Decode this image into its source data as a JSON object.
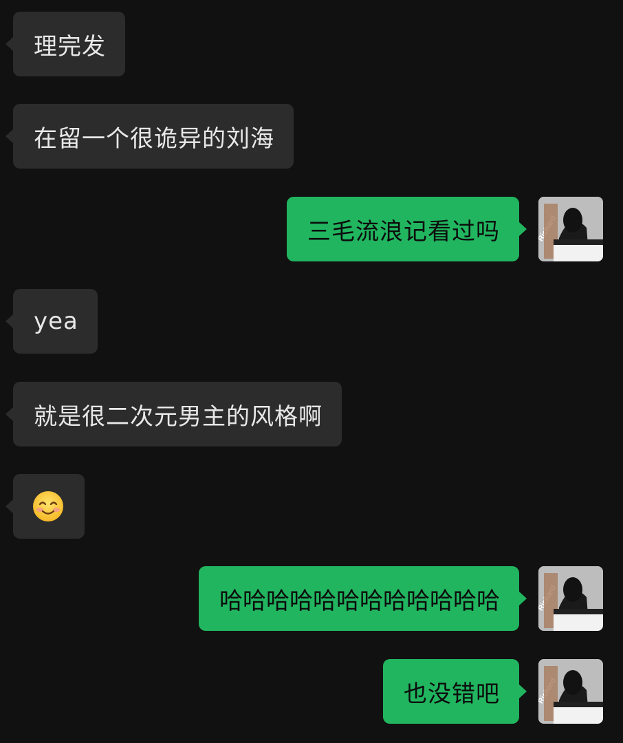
{
  "messages": [
    {
      "side": "left",
      "text": "理完发"
    },
    {
      "side": "left",
      "text": "在留一个很诡异的刘海"
    },
    {
      "side": "right",
      "text": "三毛流浪记看过吗"
    },
    {
      "side": "left",
      "text": "yea"
    },
    {
      "side": "left",
      "text": "就是很二次元男主的风格啊"
    },
    {
      "side": "left",
      "text": "",
      "emoji": "smiling-face-emoji"
    },
    {
      "side": "right",
      "text": "哈哈哈哈哈哈哈哈哈哈哈哈"
    },
    {
      "side": "right",
      "text": "也没错吧"
    }
  ],
  "avatar": {
    "watermark": "Richard"
  },
  "colors": {
    "background": "#111111",
    "incoming_bubble": "#2c2c2c",
    "outgoing_bubble": "#21b55f"
  }
}
